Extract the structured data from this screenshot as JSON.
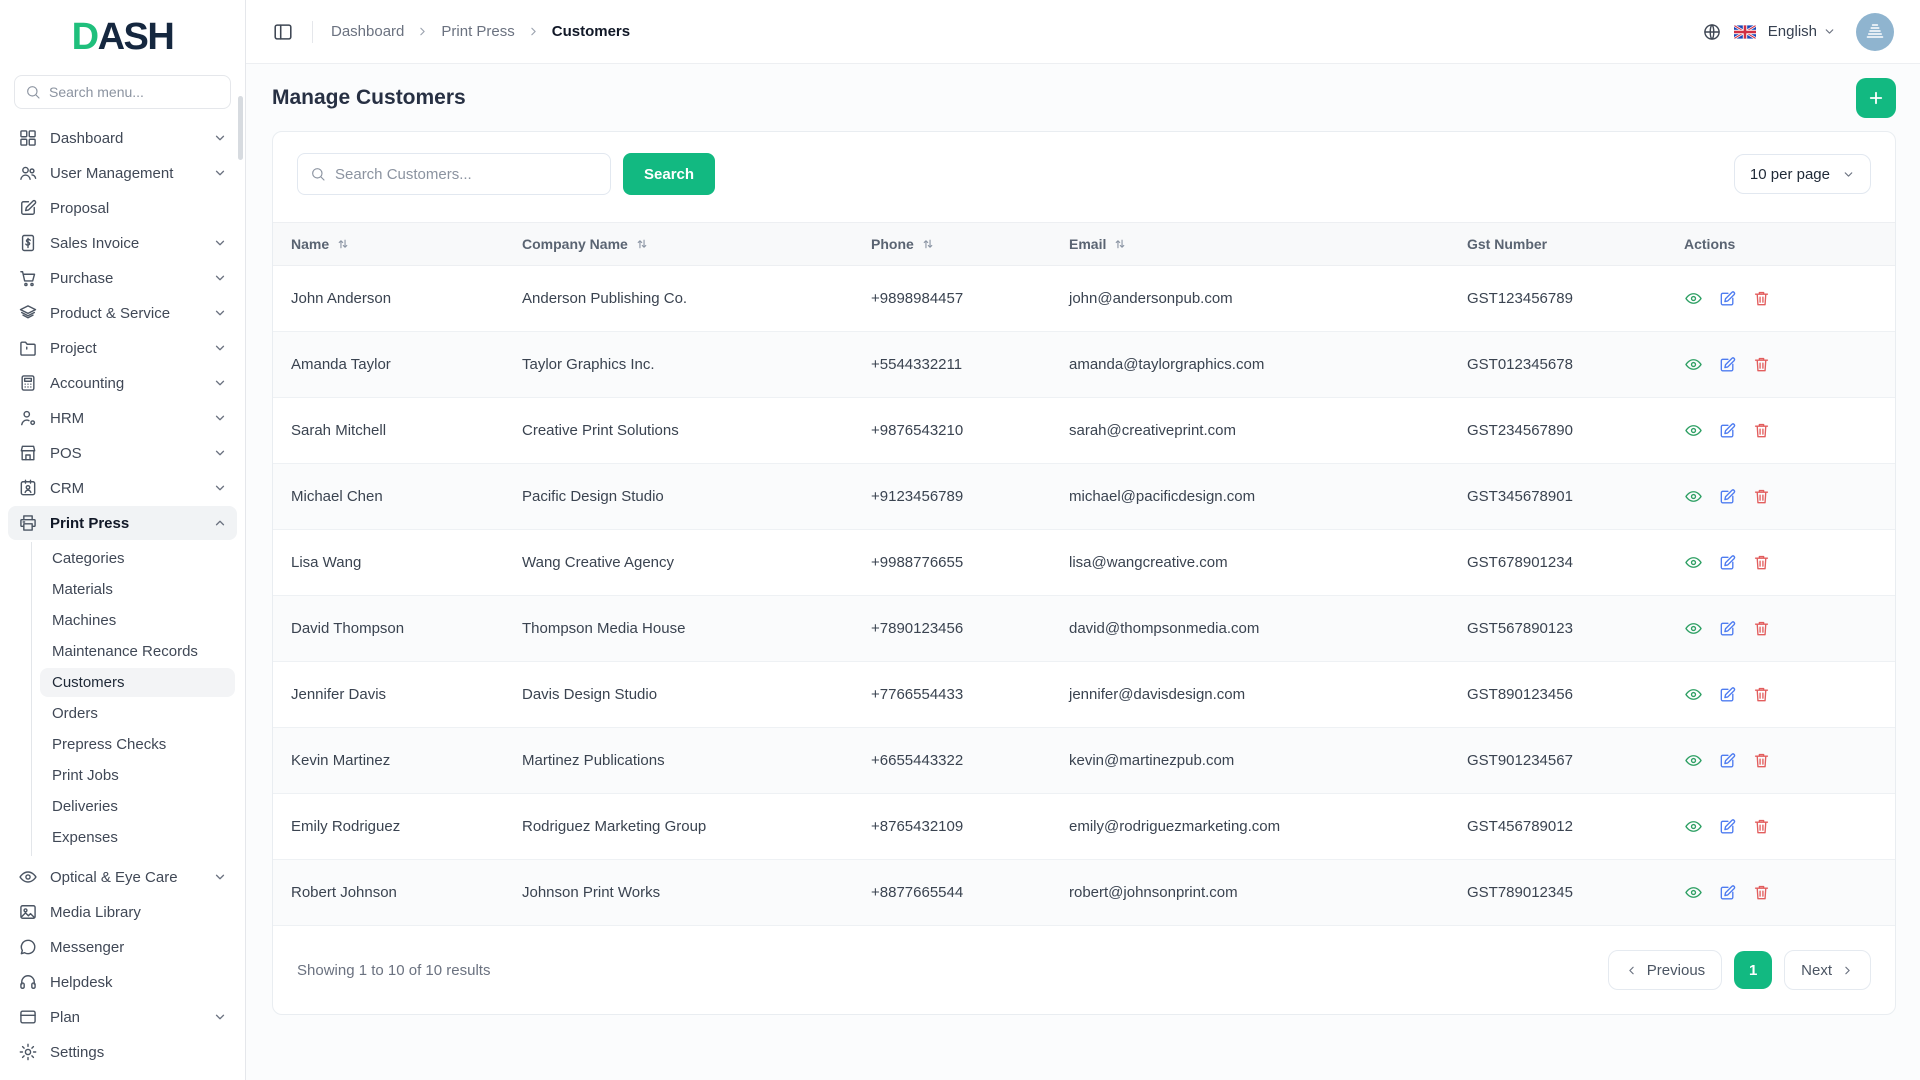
{
  "colors": {
    "accent": "#12b981",
    "logo_green": "#1fbf7c",
    "logo_navy": "#15273f",
    "view_icon": "#2d9f63",
    "edit_icon": "#4e7cf0",
    "delete_icon": "#e25d5d"
  },
  "sidebar": {
    "logo_accent_letter": "D",
    "logo_rest": "ASH",
    "search_placeholder": "Search menu...",
    "items": [
      {
        "label": "Dashboard",
        "icon": "dashboard-icon",
        "chevron": "down"
      },
      {
        "label": "User Management",
        "icon": "users-icon",
        "chevron": "down"
      },
      {
        "label": "Proposal",
        "icon": "proposal-icon"
      },
      {
        "label": "Sales Invoice",
        "icon": "invoice-icon",
        "chevron": "down"
      },
      {
        "label": "Purchase",
        "icon": "cart-icon",
        "chevron": "down"
      },
      {
        "label": "Product & Service",
        "icon": "layers-icon",
        "chevron": "down"
      },
      {
        "label": "Project",
        "icon": "folder-icon",
        "chevron": "down"
      },
      {
        "label": "Accounting",
        "icon": "calculator-icon",
        "chevron": "down"
      },
      {
        "label": "HRM",
        "icon": "person-icon",
        "chevron": "down"
      },
      {
        "label": "POS",
        "icon": "store-icon",
        "chevron": "down"
      },
      {
        "label": "CRM",
        "icon": "id-card-icon",
        "chevron": "down"
      },
      {
        "label": "Print Press",
        "icon": "printer-icon",
        "chevron": "up",
        "active": true,
        "children": [
          {
            "label": "Categories"
          },
          {
            "label": "Materials"
          },
          {
            "label": "Machines"
          },
          {
            "label": "Maintenance Records"
          },
          {
            "label": "Customers",
            "active": true
          },
          {
            "label": "Orders"
          },
          {
            "label": "Prepress Checks"
          },
          {
            "label": "Print Jobs"
          },
          {
            "label": "Deliveries"
          },
          {
            "label": "Expenses"
          }
        ]
      },
      {
        "label": "Optical & Eye Care",
        "icon": "eye-icon",
        "chevron": "down"
      },
      {
        "label": "Media Library",
        "icon": "image-icon"
      },
      {
        "label": "Messenger",
        "icon": "chat-icon"
      },
      {
        "label": "Helpdesk",
        "icon": "headset-icon"
      },
      {
        "label": "Plan",
        "icon": "credit-card-icon",
        "chevron": "down"
      },
      {
        "label": "Settings",
        "icon": "gear-icon"
      }
    ]
  },
  "topbar": {
    "breadcrumb": [
      "Dashboard",
      "Print Press",
      "Customers"
    ],
    "language": "English",
    "language_flag": "flag-uk-icon"
  },
  "page": {
    "title": "Manage Customers"
  },
  "toolbar": {
    "search_placeholder": "Search Customers...",
    "search_button": "Search",
    "per_page": "10 per page"
  },
  "table": {
    "columns": [
      {
        "label": "Name",
        "sortable": true
      },
      {
        "label": "Company Name",
        "sortable": true
      },
      {
        "label": "Phone",
        "sortable": true
      },
      {
        "label": "Email",
        "sortable": true
      },
      {
        "label": "Gst Number",
        "sortable": false
      },
      {
        "label": "Actions",
        "sortable": false
      }
    ],
    "row_actions": [
      {
        "name": "view",
        "icon": "eye-icon"
      },
      {
        "name": "edit",
        "icon": "edit-icon"
      },
      {
        "name": "delete",
        "icon": "trash-icon"
      }
    ],
    "rows": [
      {
        "name": "John Anderson",
        "company": "Anderson Publishing Co.",
        "phone": "+9898984457",
        "email": "john@andersonpub.com",
        "gst": "GST123456789"
      },
      {
        "name": "Amanda Taylor",
        "company": "Taylor Graphics Inc.",
        "phone": "+5544332211",
        "email": "amanda@taylorgraphics.com",
        "gst": "GST012345678"
      },
      {
        "name": "Sarah Mitchell",
        "company": "Creative Print Solutions",
        "phone": "+9876543210",
        "email": "sarah@creativeprint.com",
        "gst": "GST234567890"
      },
      {
        "name": "Michael Chen",
        "company": "Pacific Design Studio",
        "phone": "+9123456789",
        "email": "michael@pacificdesign.com",
        "gst": "GST345678901"
      },
      {
        "name": "Lisa Wang",
        "company": "Wang Creative Agency",
        "phone": "+9988776655",
        "email": "lisa@wangcreative.com",
        "gst": "GST678901234"
      },
      {
        "name": "David Thompson",
        "company": "Thompson Media House",
        "phone": "+7890123456",
        "email": "david@thompsonmedia.com",
        "gst": "GST567890123"
      },
      {
        "name": "Jennifer Davis",
        "company": "Davis Design Studio",
        "phone": "+7766554433",
        "email": "jennifer@davisdesign.com",
        "gst": "GST890123456"
      },
      {
        "name": "Kevin Martinez",
        "company": "Martinez Publications",
        "phone": "+6655443322",
        "email": "kevin@martinezpub.com",
        "gst": "GST901234567"
      },
      {
        "name": "Emily Rodriguez",
        "company": "Rodriguez Marketing Group",
        "phone": "+8765432109",
        "email": "emily@rodriguezmarketing.com",
        "gst": "GST456789012"
      },
      {
        "name": "Robert Johnson",
        "company": "Johnson Print Works",
        "phone": "+8877665544",
        "email": "robert@johnsonprint.com",
        "gst": "GST789012345"
      }
    ]
  },
  "pagination": {
    "summary": "Showing 1 to 10 of 10 results",
    "previous": "Previous",
    "current_page": "1",
    "next": "Next"
  }
}
